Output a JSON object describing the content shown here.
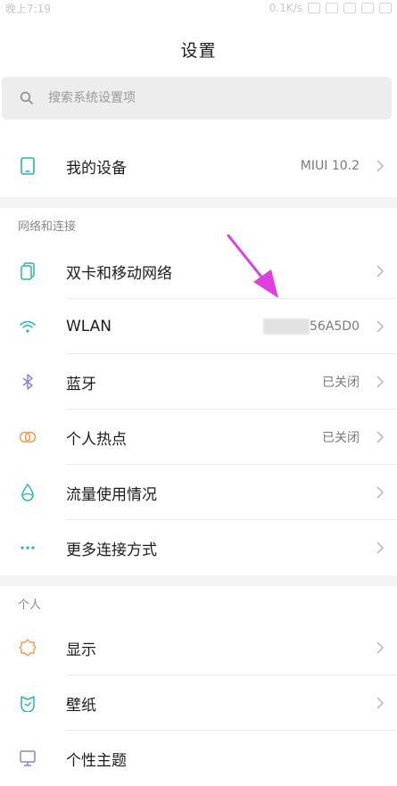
{
  "status_bar": {
    "time": "晚上7:19",
    "speed": "0.1K/s"
  },
  "header": {
    "title": "设置"
  },
  "search": {
    "placeholder": "搜索系统设置项"
  },
  "device": {
    "label": "我的设备",
    "value": "MIUI 10.2"
  },
  "section_network": {
    "title": "网络和连接"
  },
  "network_items": [
    {
      "label": "双卡和移动网络",
      "value": ""
    },
    {
      "label": "WLAN",
      "value": "56A5D0"
    },
    {
      "label": "蓝牙",
      "value": "已关闭"
    },
    {
      "label": "个人热点",
      "value": "已关闭"
    },
    {
      "label": "流量使用情况",
      "value": ""
    },
    {
      "label": "更多连接方式",
      "value": ""
    }
  ],
  "section_personal": {
    "title": "个人"
  },
  "personal_items": [
    {
      "label": "显示"
    },
    {
      "label": "壁纸"
    },
    {
      "label": "个性主题"
    }
  ],
  "colors": {
    "accent_arrow": "#e03fe0",
    "icon_teal": "#22b8b0",
    "icon_purple": "#8f7fe6",
    "icon_orange": "#f29a4a"
  },
  "icons": {
    "device": "tablet-icon",
    "sim": "sim-cards-icon",
    "wlan": "wifi-icon",
    "bluetooth": "bluetooth-icon",
    "hotspot": "hotspot-icon",
    "data": "data-usage-icon",
    "more": "more-dots-icon",
    "display": "display-brightness-icon",
    "wallpaper": "wallpaper-icon",
    "theme": "theme-icon"
  }
}
